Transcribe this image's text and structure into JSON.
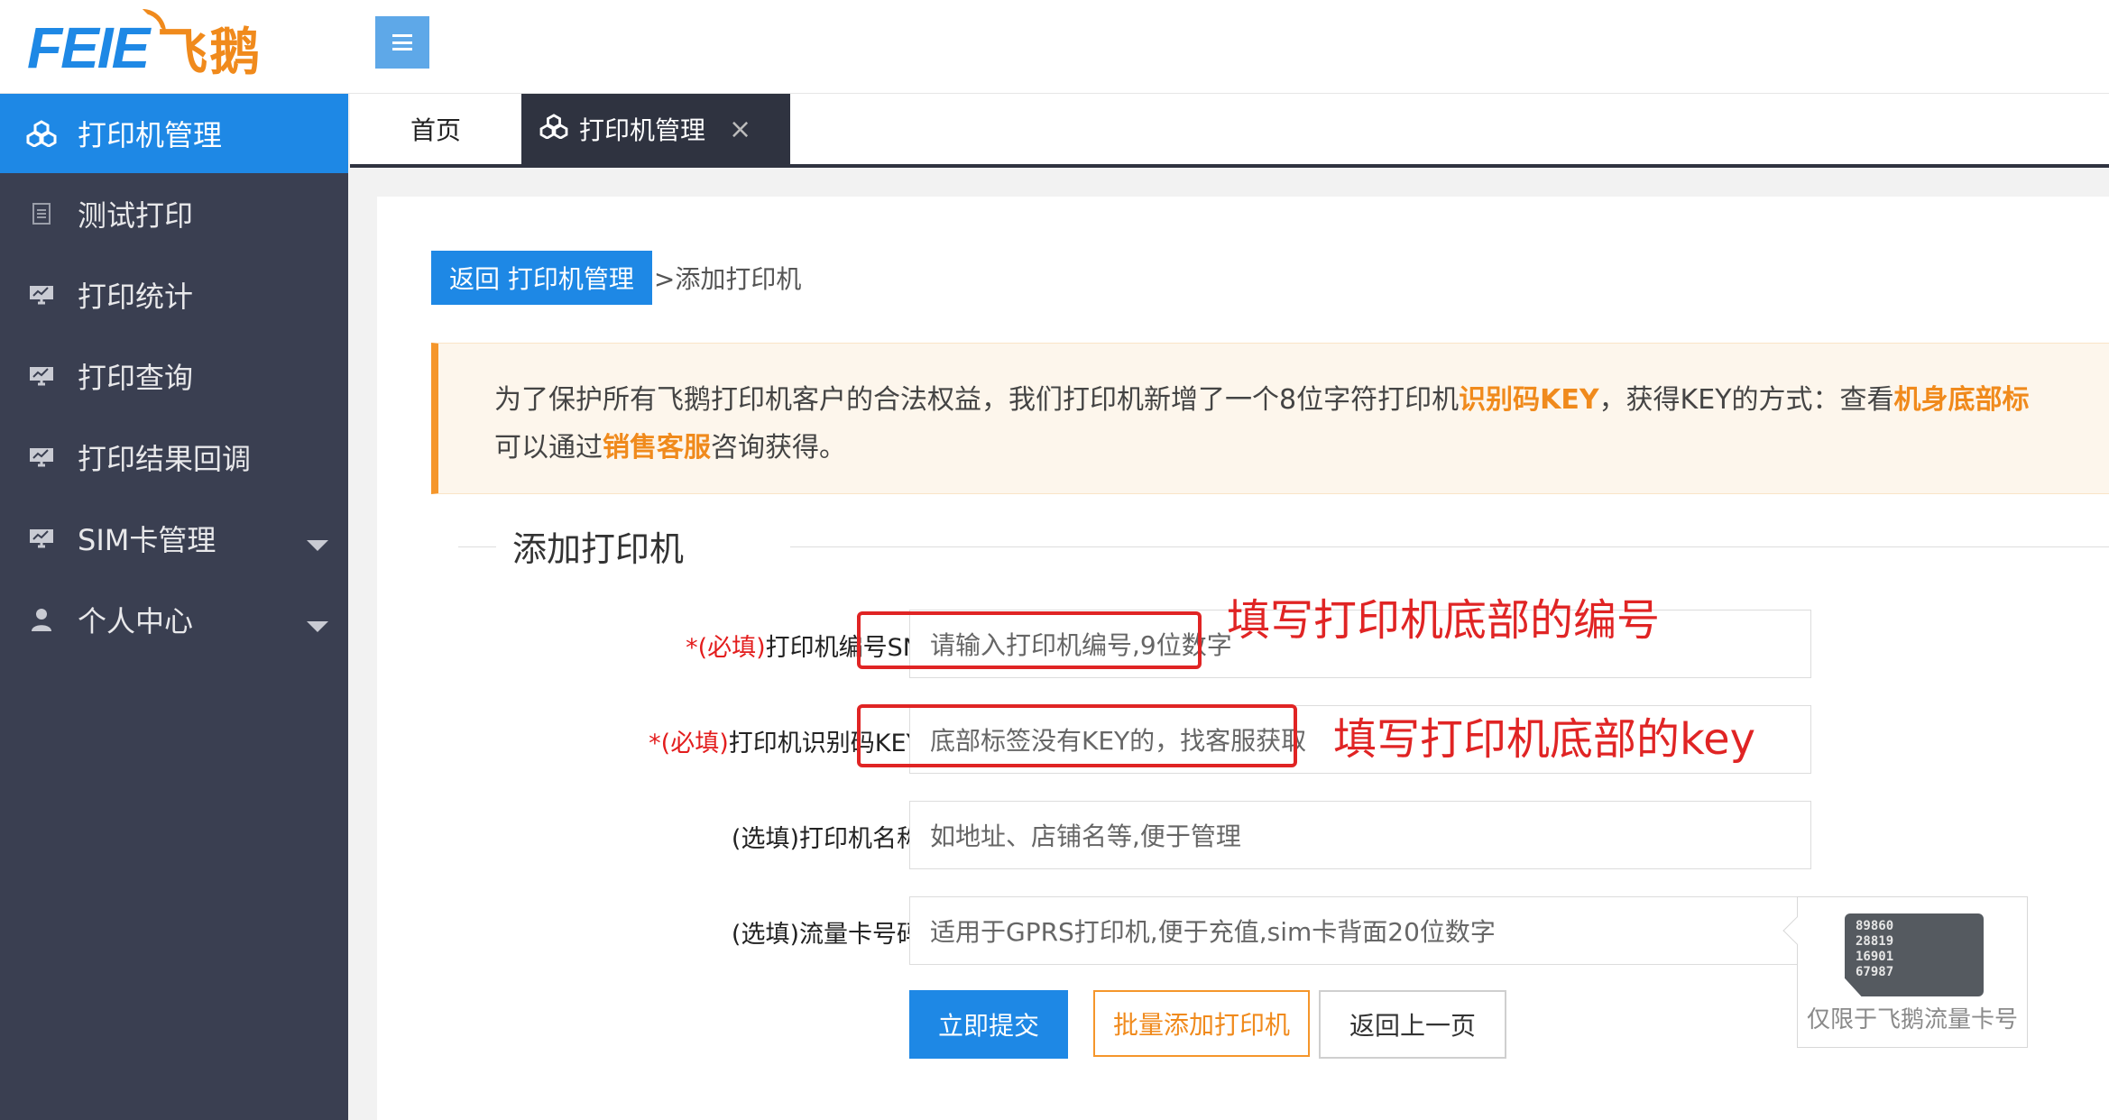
{
  "logo": {
    "brand": "FEIE",
    "cn": "飞鹅"
  },
  "sidebar": {
    "items": [
      {
        "label": "打印机管理",
        "icon": "cubes-icon",
        "active": true
      },
      {
        "label": "测试打印",
        "icon": "document-icon"
      },
      {
        "label": "打印统计",
        "icon": "monitor-chart-icon"
      },
      {
        "label": "打印查询",
        "icon": "monitor-chart-icon"
      },
      {
        "label": "打印结果回调",
        "icon": "monitor-chart-icon"
      },
      {
        "label": "SIM卡管理",
        "icon": "monitor-chart-icon",
        "caret": true
      },
      {
        "label": "个人中心",
        "icon": "user-icon",
        "caret": true
      }
    ]
  },
  "tabs": {
    "home": "首页",
    "active": "打印机管理",
    "close": "×"
  },
  "breadcrumb": {
    "back_button": "返回 打印机管理",
    "current": ">添加打印机"
  },
  "notice": {
    "line1_a": "为了保护所有飞鹅打印机客户的合法权益，我们打印机新增了一个8位字符打印机",
    "line1_b": "识别码KEY",
    "line1_c": "，获得KEY的方式：查看",
    "line1_d": "机身底部标",
    "line2_a": "可以通过",
    "line2_b": "销售客服",
    "line2_c": "咨询获得。"
  },
  "form": {
    "legend": "添加打印机",
    "fields": [
      {
        "req": "*(必填)",
        "label": "打印机编号SN：",
        "placeholder": "请输入打印机编号,9位数字"
      },
      {
        "req": "*(必填)",
        "label": "打印机识别码KEY：",
        "placeholder": "底部标签没有KEY的，找客服获取"
      },
      {
        "req": "",
        "label": "(选填)打印机名称：",
        "placeholder": "如地址、店铺名等,便于管理"
      },
      {
        "req": "",
        "label": "(选填)流量卡号码：",
        "placeholder": "适用于GPRS打印机,便于充值,sim卡背面20位数字"
      }
    ],
    "buttons": {
      "submit": "立即提交",
      "batch": "批量添加打印机",
      "back": "返回上一页"
    }
  },
  "annotations": {
    "sn": "填写打印机底部的编号",
    "key": "填写打印机底部的key"
  },
  "sim_tip": {
    "card_lines": [
      "89860",
      "28819",
      "16901",
      "67987"
    ],
    "caption": "仅限于飞鹅流量卡号"
  }
}
